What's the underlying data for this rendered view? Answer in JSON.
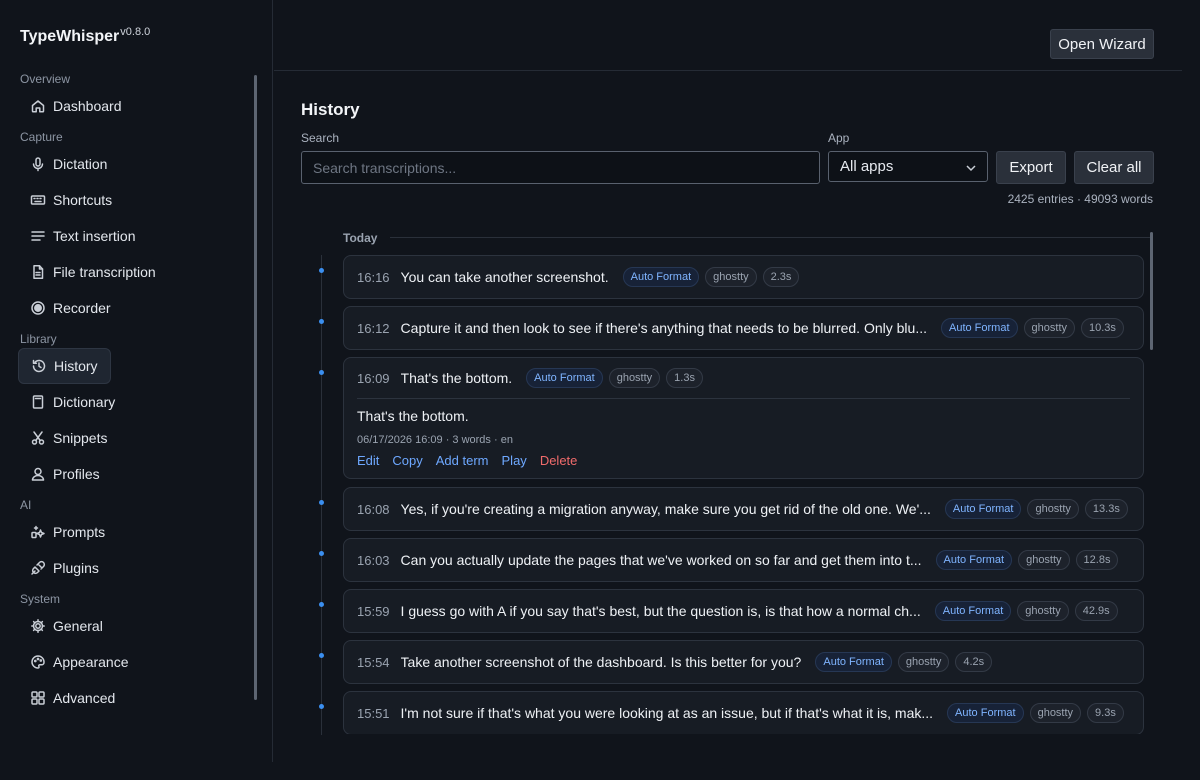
{
  "app": {
    "name": "TypeWhisper",
    "version": "v0.8.0"
  },
  "sidebar": {
    "sections": [
      {
        "label": "Overview",
        "items": [
          {
            "label": "Dashboard",
            "icon": "home-icon"
          }
        ]
      },
      {
        "label": "Capture",
        "items": [
          {
            "label": "Dictation",
            "icon": "microphone-icon"
          },
          {
            "label": "Shortcuts",
            "icon": "keyboard-icon"
          },
          {
            "label": "Text insertion",
            "icon": "text-lines-icon"
          },
          {
            "label": "File transcription",
            "icon": "file-icon"
          },
          {
            "label": "Recorder",
            "icon": "record-icon"
          }
        ]
      },
      {
        "label": "Library",
        "items": [
          {
            "label": "History",
            "icon": "history-icon",
            "active": true
          },
          {
            "label": "Dictionary",
            "icon": "book-icon"
          },
          {
            "label": "Snippets",
            "icon": "scissors-icon"
          },
          {
            "label": "Profiles",
            "icon": "user-icon"
          }
        ]
      },
      {
        "label": "AI",
        "items": [
          {
            "label": "Prompts",
            "icon": "sparkle-icon"
          },
          {
            "label": "Plugins",
            "icon": "plug-icon"
          }
        ]
      },
      {
        "label": "System",
        "items": [
          {
            "label": "General",
            "icon": "gear-icon"
          },
          {
            "label": "Appearance",
            "icon": "palette-icon"
          },
          {
            "label": "Advanced",
            "icon": "advanced-icon"
          }
        ]
      }
    ]
  },
  "header": {
    "wizard_label": "Open Wizard"
  },
  "history": {
    "title": "History",
    "search_label": "Search",
    "search_placeholder": "Search transcriptions...",
    "app_label": "App",
    "app_selected": "All apps",
    "export_label": "Export",
    "clear_label": "Clear all",
    "stats": "2425 entries · 49093 words",
    "group_label": "Today",
    "entries": [
      {
        "time": "16:16",
        "text": "You can take another screenshot.",
        "format": "Auto Format",
        "app": "ghostty",
        "duration": "2.3s"
      },
      {
        "time": "16:12",
        "text": "Capture it and then look to see if there's anything that needs to be blurred. Only blu...",
        "format": "Auto Format",
        "app": "ghostty",
        "duration": "10.3s"
      },
      {
        "time": "16:09",
        "text": "That's the bottom.",
        "format": "Auto Format",
        "app": "ghostty",
        "duration": "1.3s",
        "expanded": true,
        "full_text": "That's the bottom.",
        "meta": "06/17/2026 16:09  ·  3 words  ·  en",
        "actions": {
          "edit": "Edit",
          "copy": "Copy",
          "add_term": "Add term",
          "play": "Play",
          "delete": "Delete"
        }
      },
      {
        "time": "16:08",
        "text": "Yes, if you're creating a migration anyway, make sure you get rid of the old one. We'...",
        "format": "Auto Format",
        "app": "ghostty",
        "duration": "13.3s"
      },
      {
        "time": "16:03",
        "text": "Can you actually update the pages that we've worked on so far and get them into t...",
        "format": "Auto Format",
        "app": "ghostty",
        "duration": "12.8s"
      },
      {
        "time": "15:59",
        "text": "I guess go with A if you say that's best, but the question is, is that how a normal ch...",
        "format": "Auto Format",
        "app": "ghostty",
        "duration": "42.9s"
      },
      {
        "time": "15:54",
        "text": "Take another screenshot of the dashboard. Is this better for you?",
        "format": "Auto Format",
        "app": "ghostty",
        "duration": "4.2s"
      },
      {
        "time": "15:51",
        "text": "I'm not sure if that's what you were looking at as an issue, but if that's what it is, mak...",
        "format": "Auto Format",
        "app": "ghostty",
        "duration": "9.3s"
      }
    ]
  },
  "colors": {
    "accent": "#3b8ff0",
    "format_badge": "#7fb4ff",
    "danger": "#f06b6b",
    "background": "#10141b"
  }
}
